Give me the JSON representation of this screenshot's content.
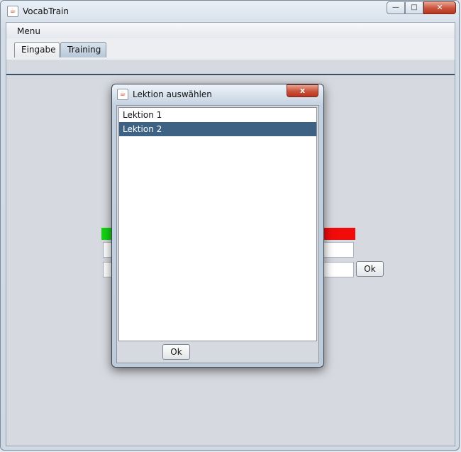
{
  "window": {
    "title": "VocabTrain",
    "app_icon": "java-cup-icon"
  },
  "window_controls": {
    "minimize": "—",
    "maximize": "□",
    "close": "✕"
  },
  "menubar": {
    "items": [
      {
        "label": "Menu"
      }
    ]
  },
  "tabs": [
    {
      "label": "Eingabe",
      "active": false
    },
    {
      "label": "Training",
      "active": true
    }
  ],
  "training": {
    "ok_label": "Ok",
    "indicator_colors": {
      "correct": "#13d413",
      "wrong": "#f20b0b"
    }
  },
  "dialog": {
    "title": "Lektion auswählen",
    "close_label": "x",
    "items": [
      {
        "label": "Lektion 1",
        "selected": false
      },
      {
        "label": "Lektion 2",
        "selected": true
      }
    ],
    "ok_label": "Ok",
    "selection_color": "#3e6283"
  }
}
